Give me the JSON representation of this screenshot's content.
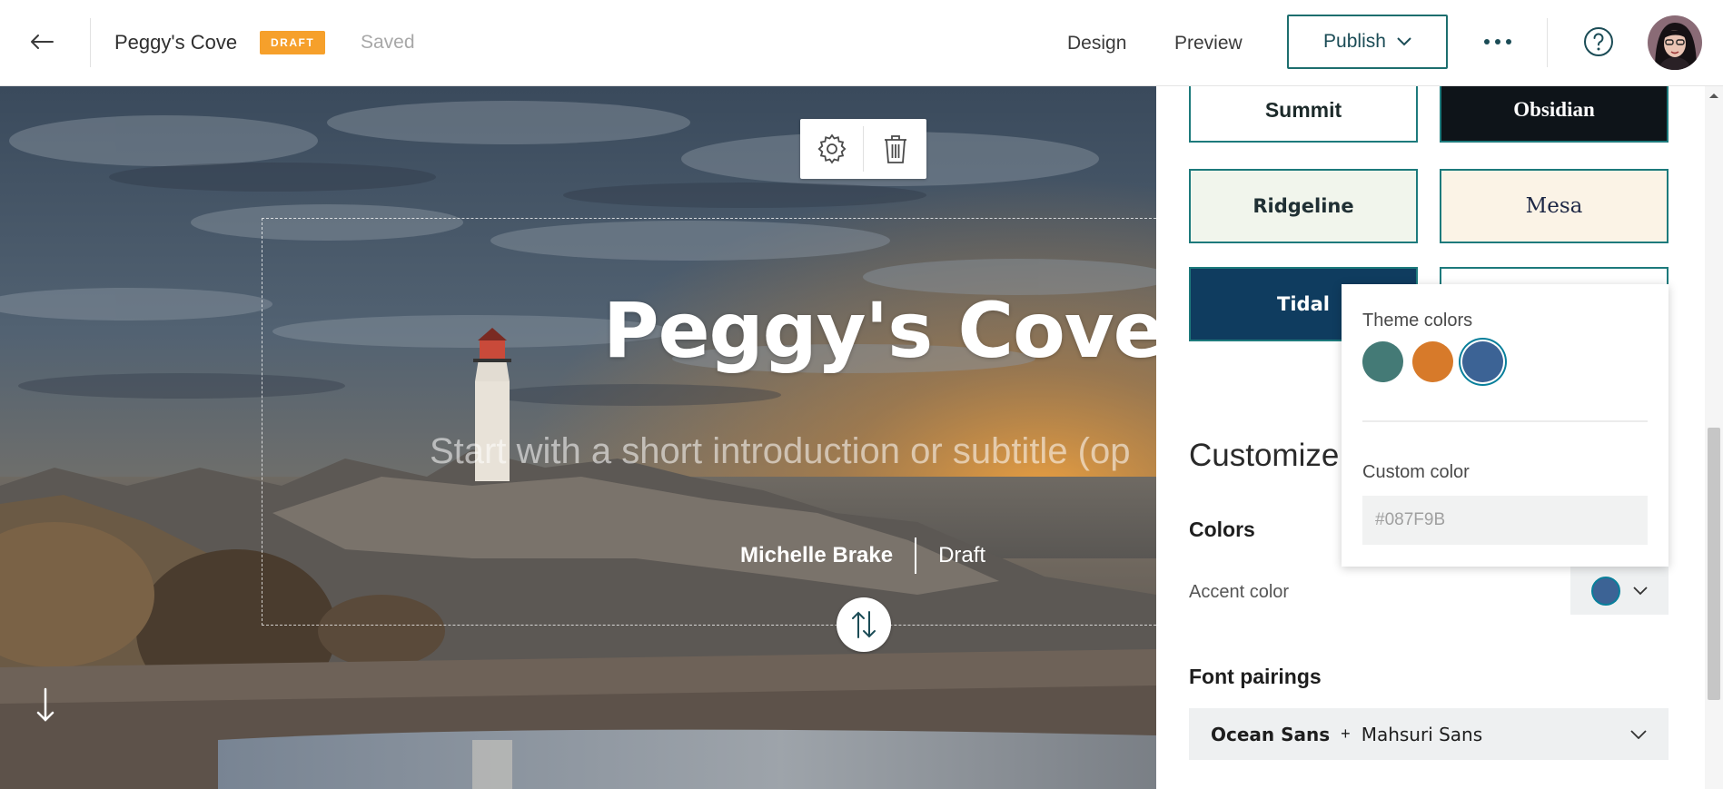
{
  "header": {
    "back_icon": "arrow-left-icon",
    "story_title": "Peggy's Cove",
    "status_badge": "DRAFT",
    "save_status": "Saved",
    "nav": {
      "design": "Design",
      "preview": "Preview"
    },
    "publish_label": "Publish",
    "more_icon": "more-horizontal-icon",
    "help_icon": "help-circle-icon"
  },
  "hero": {
    "title": "Peggy's Cove",
    "subtitle_placeholder": "Start with a short introduction or subtitle (op",
    "author": "Michelle Brake",
    "status": "Draft",
    "toolbar_icons": [
      "gear-icon",
      "trash-icon"
    ],
    "swap_icon": "swap-vertical-icon",
    "scroll_icon": "arrow-down-icon"
  },
  "panel": {
    "themes": [
      {
        "label": "Summit"
      },
      {
        "label": "Obsidian"
      },
      {
        "label": "Ridgeline"
      },
      {
        "label": "Mesa"
      },
      {
        "label": "Tidal"
      }
    ],
    "customize_title": "Customize",
    "colors_heading": "Colors",
    "accent_label": "Accent color",
    "fonts_heading": "Font pairings",
    "font_primary": "Ocean Sans",
    "font_plus": "+",
    "font_secondary": "Mahsuri Sans"
  },
  "color_popover": {
    "theme_colors_label": "Theme colors",
    "theme_colors": [
      "#447a76",
      "#d77a2a",
      "#3c6395"
    ],
    "selected_index": 2,
    "custom_color_label": "Custom color",
    "custom_color_placeholder": "#087F9B"
  },
  "colors": {
    "accent_teal": "#087f9b",
    "badge_orange": "#f6a02b",
    "tidal_navy": "#0f3c5f"
  }
}
